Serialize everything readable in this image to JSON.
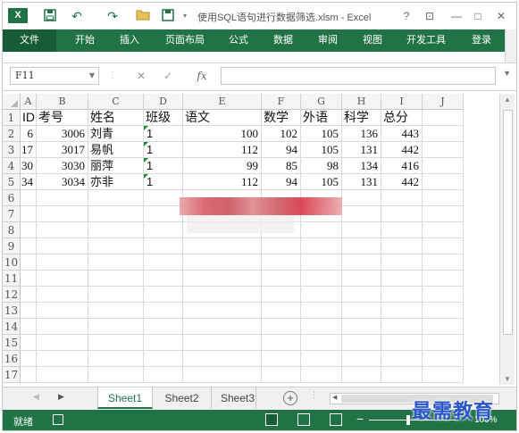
{
  "titlebar": {
    "app_badge": "X",
    "save_glyph": "💾",
    "undo_glyph": "↶",
    "redo_glyph": "↷",
    "open_glyph": "📂",
    "title": "使用SQL语句进行数据筛选.xlsm - Excel",
    "help": "?",
    "ribbon_display": "⊡",
    "minimize": "—",
    "maximize": "□",
    "close": "✕"
  },
  "ribbon": {
    "tabs": [
      "文件",
      "开始",
      "插入",
      "页面布局",
      "公式",
      "数据",
      "审阅",
      "视图",
      "开发工具",
      "登录"
    ]
  },
  "formula_bar": {
    "name_box": "F11",
    "cancel": "✕",
    "enter": "✓",
    "fx": "fx",
    "value": ""
  },
  "grid": {
    "columns": [
      "A",
      "B",
      "C",
      "D",
      "E",
      "F",
      "G",
      "H",
      "I",
      "J"
    ],
    "rows": [
      "1",
      "2",
      "3",
      "4",
      "5",
      "6",
      "7",
      "8",
      "9",
      "10",
      "11",
      "12",
      "13",
      "14",
      "15",
      "16",
      "17"
    ],
    "headers": [
      "ID",
      "考号",
      "姓名",
      "班级",
      "语文",
      "数学",
      "外语",
      "科学",
      "总分"
    ],
    "data": [
      [
        "6",
        "3006",
        "刘青",
        "1",
        "100",
        "102",
        "105",
        "136",
        "443"
      ],
      [
        "17",
        "3017",
        "易帆",
        "1",
        "112",
        "94",
        "105",
        "131",
        "442"
      ],
      [
        "30",
        "3030",
        "丽萍",
        "1",
        "99",
        "85",
        "98",
        "134",
        "416"
      ],
      [
        "34",
        "3034",
        "亦非",
        "1",
        "112",
        "94",
        "105",
        "131",
        "442"
      ]
    ]
  },
  "sheets": {
    "tabs": [
      "Sheet1",
      "Sheet2",
      "Sheet3"
    ],
    "active": "Sheet1",
    "add": "+"
  },
  "statusbar": {
    "status": "就绪",
    "zoom": "100%"
  },
  "watermark": "最需教育",
  "colors": {
    "excel_green": "#217346",
    "excel_green_dark": "#185c37"
  }
}
